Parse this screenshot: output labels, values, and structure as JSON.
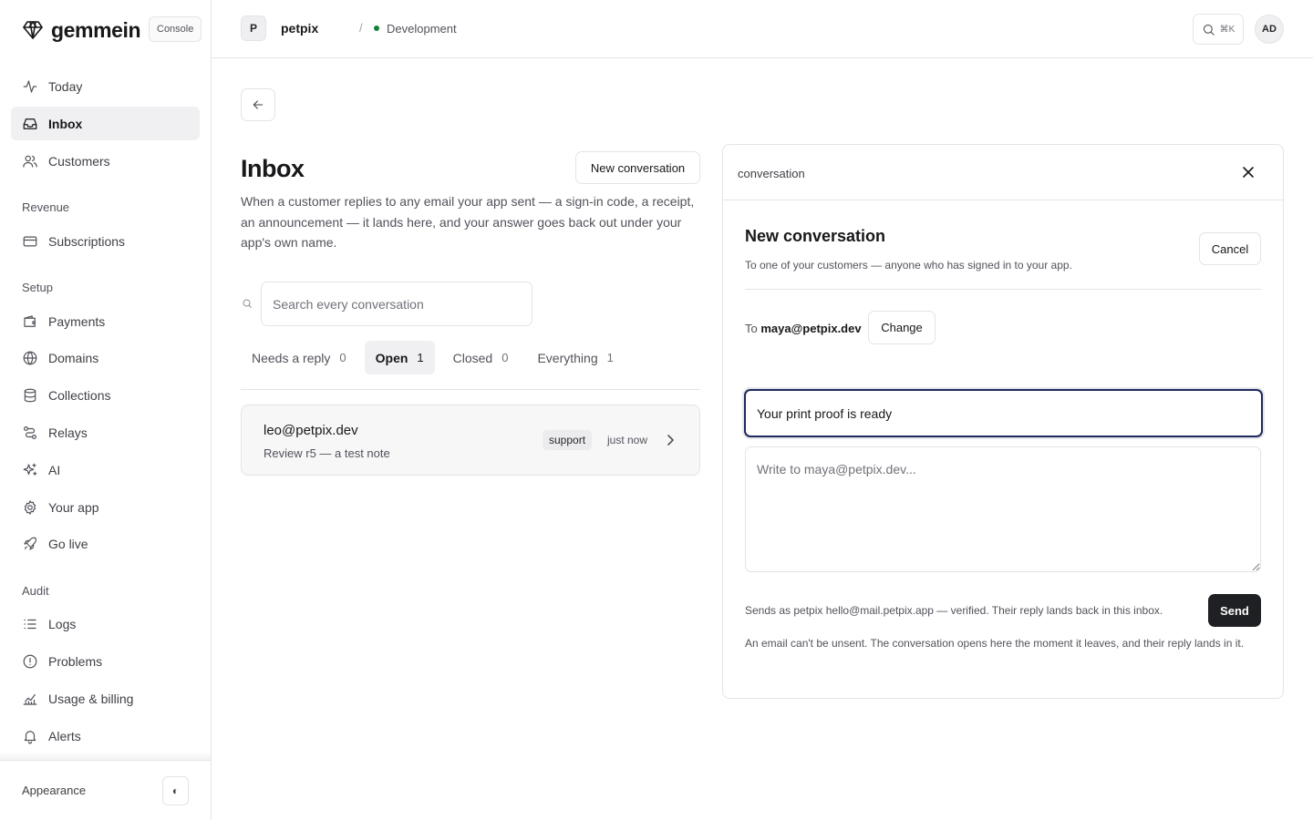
{
  "brand": {
    "name": "gemmein",
    "badge": "Console"
  },
  "sidebar": {
    "items": [
      {
        "label": "Today"
      },
      {
        "label": "Inbox"
      },
      {
        "label": "Customers"
      },
      {
        "label": "Subscriptions"
      },
      {
        "label": "Payments"
      },
      {
        "label": "Domains"
      },
      {
        "label": "Collections"
      },
      {
        "label": "Relays"
      },
      {
        "label": "AI"
      },
      {
        "label": "Your app"
      },
      {
        "label": "Go live"
      },
      {
        "label": "Logs"
      },
      {
        "label": "Problems"
      },
      {
        "label": "Usage & billing"
      },
      {
        "label": "Alerts"
      }
    ],
    "sections": [
      "Revenue",
      "Setup",
      "Audit"
    ],
    "active": "Inbox",
    "appearance_label": "Appearance",
    "appearance_toggle": "◐"
  },
  "topbar": {
    "project_initial": "P",
    "project_name": "petpix",
    "separator": "/",
    "environment": "Development",
    "search_shortcut": "⌘K",
    "user_initials": "AD"
  },
  "inbox": {
    "title": "Inbox",
    "new_button": "New conversation",
    "description": "When a customer replies to any email your app sent — a sign-in code, a receipt, an announcement — it lands here, and your answer goes back out under your app's own name.",
    "search_placeholder": "Search every conversation",
    "tabs": [
      {
        "label": "Needs a reply",
        "count": "0"
      },
      {
        "label": "Open",
        "count": "1"
      },
      {
        "label": "Closed",
        "count": "0"
      },
      {
        "label": "Everything",
        "count": "1"
      }
    ],
    "active_tab": "Open",
    "conversations": [
      {
        "from": "leo@petpix.dev",
        "preview": "Review r5 — a test note",
        "tag": "support",
        "time": "just now"
      }
    ]
  },
  "panel": {
    "label": "conversation",
    "title": "New conversation",
    "subtitle": "To one of your customers — anyone who has signed in to your app.",
    "cancel_label": "Cancel",
    "to_prefix": "To",
    "to_email": "maya@petpix.dev",
    "change_label": "Change",
    "subject_value": "Your print proof is ready",
    "body_placeholder": "Write to maya@petpix.dev...",
    "sends_as": "Sends as petpix hello@mail.petpix.app — verified. Their reply lands back in this inbox.",
    "send_label": "Send",
    "warning": "An email can't be unsent. The conversation opens here the moment it leaves, and their reply lands in it."
  },
  "colors": {
    "accent": "#1e2a5a",
    "env_dot": "#15803d",
    "send_bg": "#1f2023"
  }
}
